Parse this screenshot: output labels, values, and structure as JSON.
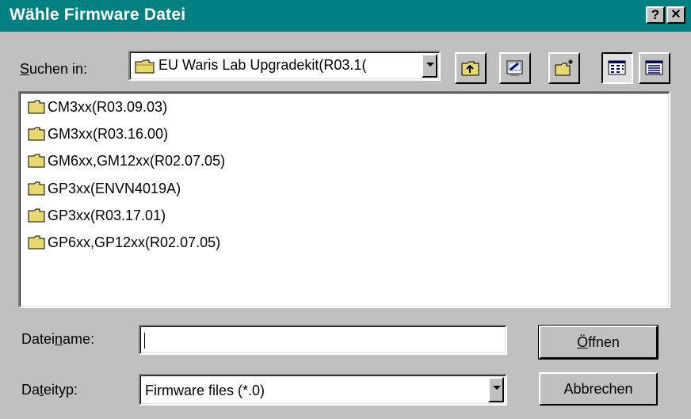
{
  "window": {
    "title": "Wähle Firmware Datei",
    "help_label": "?",
    "close_label": "✕"
  },
  "lookin": {
    "label_prefix": "",
    "label_accel": "S",
    "label_rest": "uchen in:",
    "value": "EU Waris Lab Upgradekit(R03.1("
  },
  "toolbar": {
    "buttons": [
      {
        "name": "up-one-level-icon"
      },
      {
        "name": "desktop-icon"
      },
      {
        "name": "new-folder-icon"
      },
      {
        "name": "list-view-icon",
        "pressed": true
      },
      {
        "name": "details-view-icon"
      }
    ]
  },
  "files": [
    {
      "label": "CM3xx(R03.09.03)"
    },
    {
      "label": "GM3xx(R03.16.00)"
    },
    {
      "label": "GM6xx,GM12xx(R02.07.05)"
    },
    {
      "label": "GP3xx(ENVN4019A)"
    },
    {
      "label": "GP3xx(R03.17.01)"
    },
    {
      "label": "GP6xx,GP12xx(R02.07.05)"
    }
  ],
  "filename": {
    "label_prefix": "Datei",
    "label_accel": "n",
    "label_rest": "ame:",
    "value": ""
  },
  "filetype": {
    "label_prefix": "Da",
    "label_accel": "t",
    "label_rest": "eityp:",
    "value": "Firmware files (*.0)"
  },
  "buttons": {
    "open_accel": "Ö",
    "open_rest": "ffnen",
    "cancel": "Abbrechen"
  },
  "colors": {
    "titlebar": "#008080",
    "face": "#c0c0c0",
    "folder": "#e8d870"
  }
}
